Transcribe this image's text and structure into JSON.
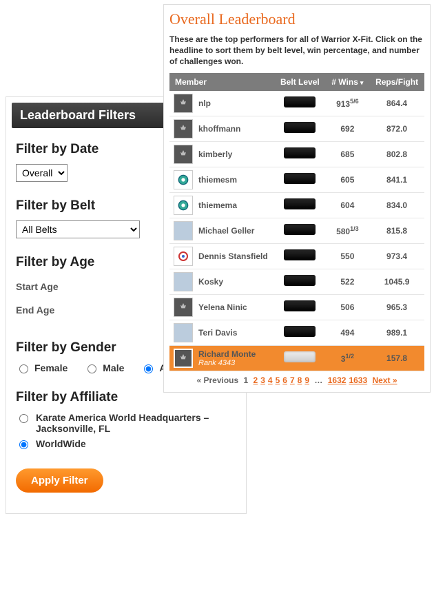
{
  "filters": {
    "headerTitle": "Leaderboard Filters",
    "date": {
      "label": "Filter by Date",
      "selected": "Overall"
    },
    "belt": {
      "label": "Filter by Belt",
      "selected": "All Belts"
    },
    "age": {
      "label": "Filter by Age",
      "startLabel": "Start Age",
      "endLabel": "End Age",
      "start": "",
      "end": ""
    },
    "gender": {
      "label": "Filter by Gender",
      "options": {
        "female": "Female",
        "male": "Male",
        "any": "Any"
      },
      "selected": "any"
    },
    "affiliate": {
      "label": "Filter by Affiliate",
      "options": {
        "hq": "Karate America World Headquarters – Jacksonville, FL",
        "worldwide": "WorldWide"
      },
      "selected": "worldwide"
    },
    "applyLabel": "Apply Filter"
  },
  "board": {
    "title": "Overall Leaderboard",
    "subtitle": "These are the top performers for all of Warrior X-Fit. Click on the headline to sort them by belt level, win percentage, and number of challenges won.",
    "columns": {
      "member": "Member",
      "belt": "Belt Level",
      "wins": "# Wins",
      "reps": "Reps/Fight"
    },
    "rows": [
      {
        "name": "nlp",
        "wins": "913",
        "winsSup": "5/6",
        "reps": "864.4",
        "avatar": "default"
      },
      {
        "name": "khoffmann",
        "wins": "692",
        "winsSup": "",
        "reps": "872.0",
        "avatar": "default"
      },
      {
        "name": "kimberly",
        "wins": "685",
        "winsSup": "",
        "reps": "802.8",
        "avatar": "default"
      },
      {
        "name": "thiemesm",
        "wins": "605",
        "winsSup": "",
        "reps": "841.1",
        "avatar": "badge"
      },
      {
        "name": "thiemema",
        "wins": "604",
        "winsSup": "",
        "reps": "834.0",
        "avatar": "badge"
      },
      {
        "name": "Michael Geller",
        "wins": "580",
        "winsSup": "1/3",
        "reps": "815.8",
        "avatar": "photo"
      },
      {
        "name": "Dennis Stansfield",
        "wins": "550",
        "winsSup": "",
        "reps": "973.4",
        "avatar": "ring"
      },
      {
        "name": "Kosky",
        "wins": "522",
        "winsSup": "",
        "reps": "1045.9",
        "avatar": "photo"
      },
      {
        "name": "Yelena Ninic",
        "wins": "506",
        "winsSup": "",
        "reps": "965.3",
        "avatar": "default"
      },
      {
        "name": "Teri Davis",
        "wins": "494",
        "winsSup": "",
        "reps": "989.1",
        "avatar": "photo"
      }
    ],
    "me": {
      "name": "Richard Monte",
      "rank": "Rank 4343",
      "wins": "3",
      "winsSup": "1/2",
      "reps": "157.8"
    },
    "pager": {
      "prev": "« Previous",
      "current": "1",
      "pages": [
        "2",
        "3",
        "4",
        "5",
        "6",
        "7",
        "8",
        "9"
      ],
      "ellipsis": "…",
      "lastPages": [
        "1632",
        "1633"
      ],
      "next": "Next »"
    }
  }
}
